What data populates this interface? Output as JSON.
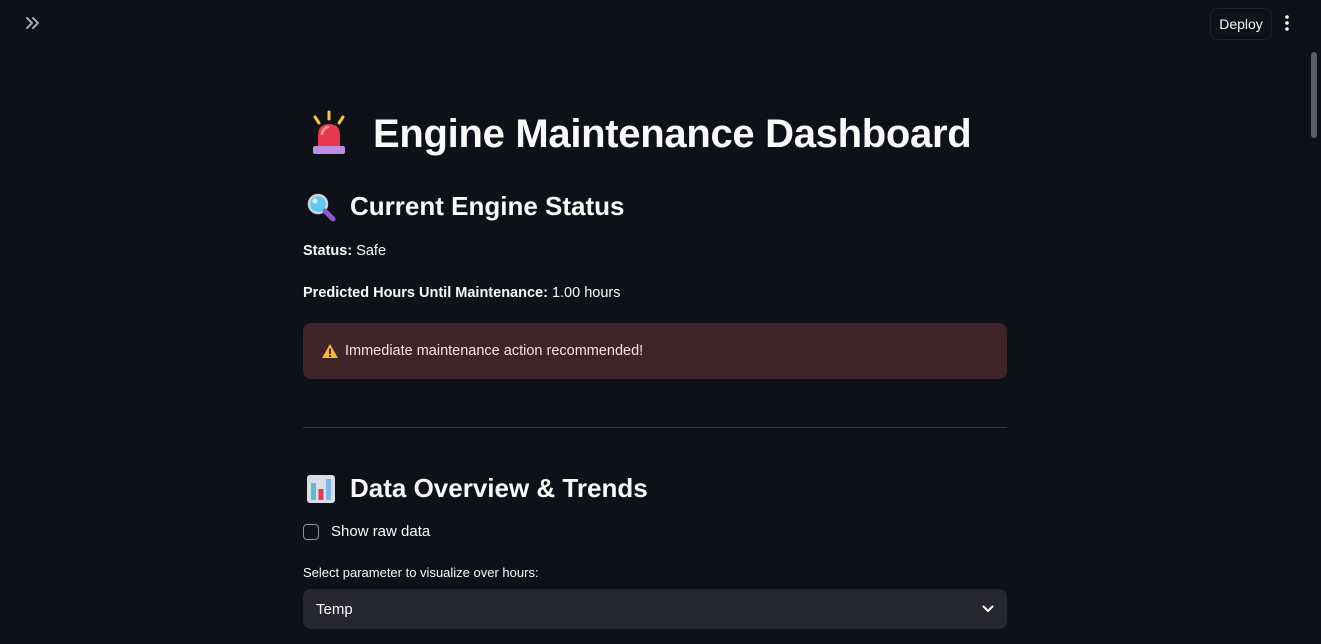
{
  "header": {
    "expand_icon": "chevrons-right-icon",
    "deploy_label": "Deploy",
    "menu_icon": "vertical-ellipsis-icon"
  },
  "page": {
    "title_icon": "police-light-emoji",
    "title": "Engine Maintenance Dashboard"
  },
  "status_section": {
    "icon": "magnifying-glass-emoji",
    "heading": "Current Engine Status",
    "status_label": "Status:",
    "status_value": "Safe",
    "hours_label": "Predicted Hours Until Maintenance:",
    "hours_value": "1.00 hours",
    "alert": {
      "icon": "warning-icon",
      "message": "Immediate maintenance action recommended!",
      "color": "#3e2428"
    }
  },
  "data_section": {
    "icon": "bar-chart-emoji",
    "heading": "Data Overview & Trends",
    "raw_data_checkbox": {
      "label": "Show raw data",
      "checked": false
    },
    "parameter_select": {
      "label": "Select parameter to visualize over hours:",
      "value": "Temp"
    }
  },
  "colors": {
    "background": "#0e1117",
    "text": "#fafafa",
    "alert_bg": "#3e2428",
    "input_bg": "#262730"
  }
}
